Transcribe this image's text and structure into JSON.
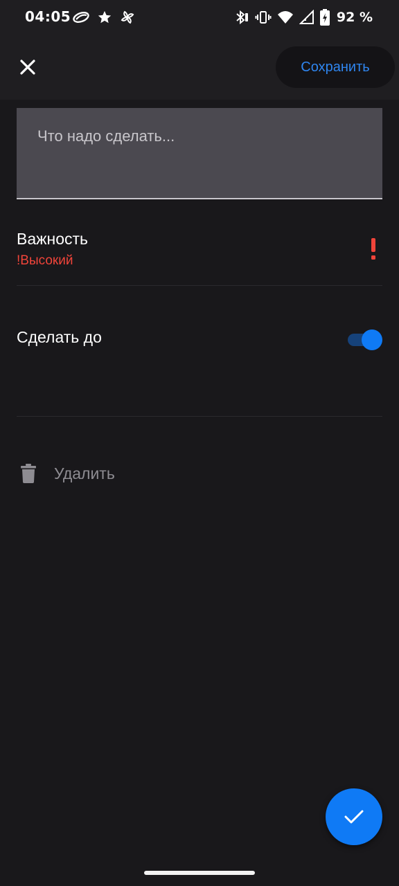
{
  "status_bar": {
    "time": "04:05",
    "battery_text": "92 %",
    "left_icons": [
      "app-notification-icon",
      "star-icon",
      "fan-icon"
    ],
    "right_icons": [
      "bluetooth-icon",
      "vibrate-icon",
      "wifi-icon",
      "signal-icon",
      "battery-icon"
    ]
  },
  "app_bar": {
    "close_icon": "close-icon",
    "save_label": "Сохранить"
  },
  "task_field": {
    "placeholder": "Что надо сделать..."
  },
  "importance": {
    "title": "Важность",
    "value": "!Высокий",
    "icon": "exclamation-icon"
  },
  "deadline": {
    "title": "Сделать до",
    "toggle_on": true
  },
  "delete": {
    "label": "Удалить",
    "icon": "trash-icon"
  },
  "fab": {
    "icon": "checkmark-icon"
  },
  "colors": {
    "background": "#19181b",
    "accent": "#0f7af5",
    "save_text": "#2f86f0",
    "importance_red": "#f0443a",
    "field_background": "#4b4950",
    "muted_text": "#8e8c92"
  }
}
